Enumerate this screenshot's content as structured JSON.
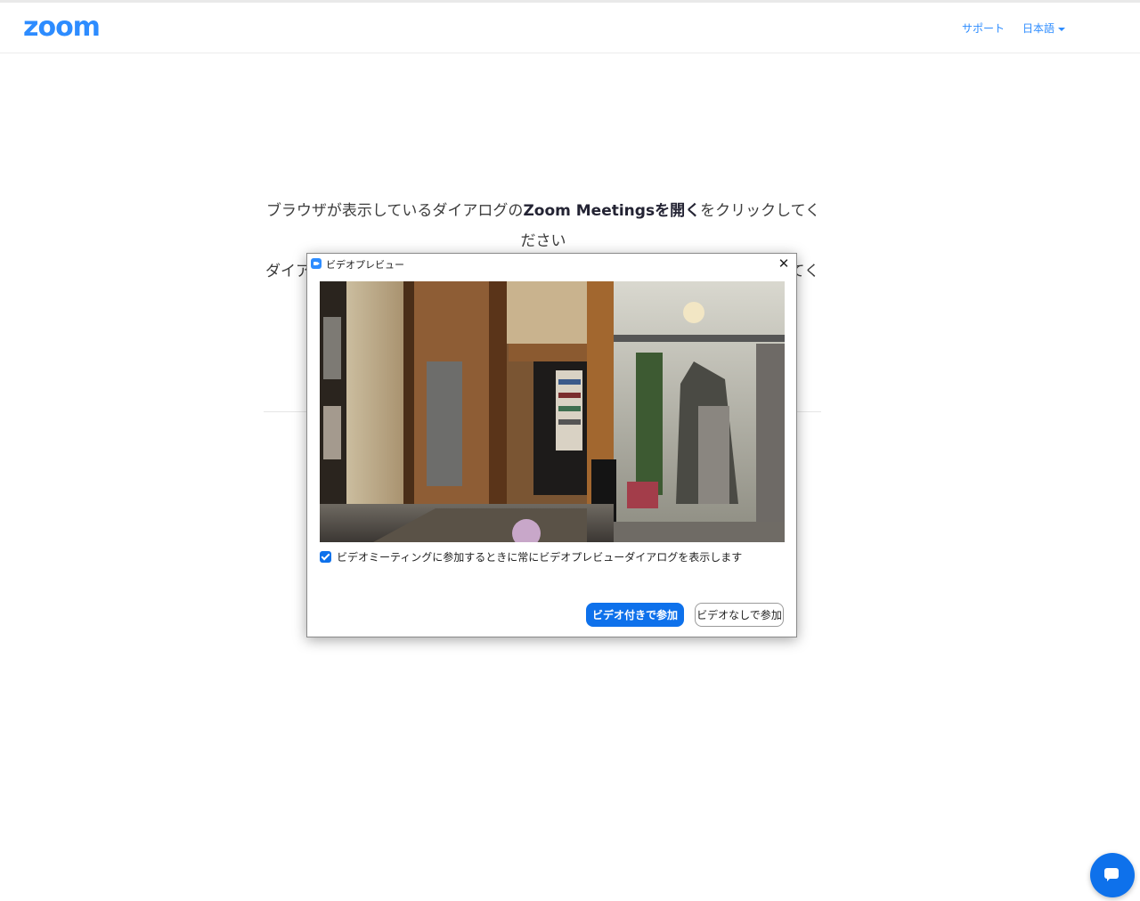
{
  "header": {
    "logo_text": "zoom",
    "nav": {
      "support": "サポート",
      "language": "日本語"
    }
  },
  "main": {
    "message_line1_pre": "ブラウザが表示しているダイアログの",
    "message_line1_bold": "Zoom Meetingsを開く",
    "message_line1_post": "をクリックしてく",
    "message_line1_cont": "ださい",
    "message_line2_start": "ダイア",
    "message_line2_end": "てく"
  },
  "dialog": {
    "title": "ビデオプレビュー",
    "close_glyph": "✕",
    "checkbox_checked": true,
    "checkbox_label": "ビデオミーティングに参加するときに常にビデオプレビューダイアログを表示します",
    "join_with_video": "ビデオ付きで参加",
    "join_without_video": "ビデオなしで参加"
  },
  "colors": {
    "brand": "#2d8cff",
    "primary_button": "#0e71eb"
  },
  "icons": {
    "app": "zoom-app-icon",
    "close": "close-icon",
    "chat": "chat-bubble-icon",
    "dropdown": "caret-down-icon"
  }
}
